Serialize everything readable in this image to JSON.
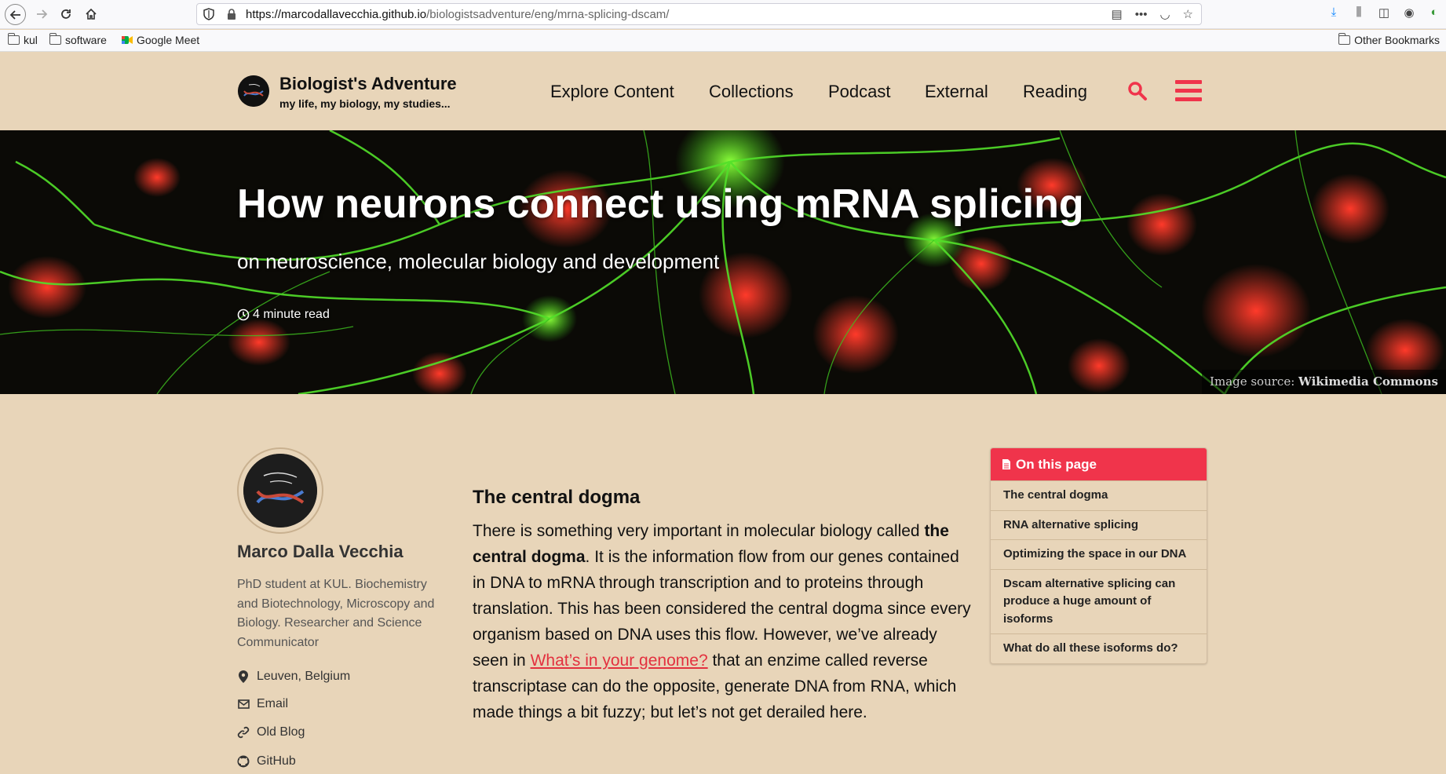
{
  "browser": {
    "url_host": "https://marcodallavecchia.github.io",
    "url_path": "/biologistsadventure/eng/mrna-splicing-dscam/",
    "bookmarks": [
      "kul",
      "software",
      "Google Meet"
    ],
    "other_bookmarks": "Other Bookmarks"
  },
  "site": {
    "title": "Biologist's Adventure",
    "subtitle": "my life, my biology, my studies...",
    "nav": [
      "Explore Content",
      "Collections",
      "Podcast",
      "External",
      "Reading"
    ],
    "accent_color": "#f0344b"
  },
  "hero": {
    "title": "How neurons connect using mRNA splicing",
    "subtitle": "on neuroscience, molecular biology and development",
    "read_time": "4 minute read",
    "image_source_label": "Image source:",
    "image_source_link": "Wikimedia Commons"
  },
  "author": {
    "name": "Marco Dalla Vecchia",
    "bio": "PhD student at KUL. Biochemistry and Biotechnology, Microscopy and Biology. Researcher and Science Communicator",
    "location": "Leuven, Belgium",
    "links": [
      "Email",
      "Old Blog",
      "GitHub"
    ]
  },
  "article": {
    "heading": "The central dogma",
    "p_part1": "There is something very important in molecular biology called ",
    "p_bold": "the central dogma",
    "p_part2": ". It is the information flow from our genes contained in DNA to mRNA through transcription and to proteins through translation. This has been considered the central dogma since every organism based on DNA uses this flow. However, we’ve already seen in ",
    "p_link": "What’s in your genome?",
    "p_part3": " that an enzime called reverse transcriptase can do the opposite, generate DNA from RNA, which made things a bit fuzzy; but let’s not get derailed here."
  },
  "toc": {
    "title": "On this page",
    "items": [
      "The central dogma",
      "RNA alternative splicing",
      "Optimizing the space in our DNA",
      "Dscam alternative splicing can produce a huge amount of isoforms",
      "What do all these isoforms do?"
    ]
  }
}
